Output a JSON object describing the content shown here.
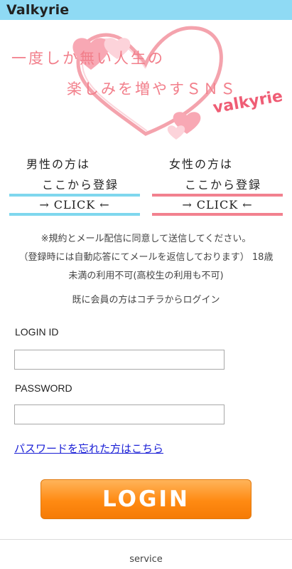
{
  "header": {
    "title": "Valkyrie"
  },
  "hero": {
    "line1": "一度しか無い人生の",
    "line2": "楽しみを増やすＳＮＳ",
    "brand": "valkyrie"
  },
  "register": {
    "male": {
      "who": "男性の方は",
      "here": "ここから登録",
      "click": "→ CLICK ←"
    },
    "female": {
      "who": "女性の方は",
      "here": "ここから登録",
      "click": "→ CLICK ←"
    }
  },
  "notice": {
    "line1": "※規約とメール配信に同意して送信してください。",
    "line2": "（登録時には自動応答にてメールを返信しております） 18歳",
    "line3": "未満の利用不可(高校生の利用も不可)"
  },
  "existing_member": "既に会員の方はコチラからログイン",
  "form": {
    "login_id_label": "LOGIN ID",
    "login_id_value": "",
    "password_label": "PASSWORD",
    "password_value": "",
    "forgot_link": "パスワードを忘れた方はこちら",
    "login_button": "LOGIN"
  },
  "footer": {
    "service": "service"
  },
  "colors": {
    "header_bg": "#8fdaf4",
    "male_accent": "#7fd7ee",
    "female_accent": "#f2818f",
    "login_orange": "#ff8a12",
    "hero_pink": "#f27f8b"
  }
}
